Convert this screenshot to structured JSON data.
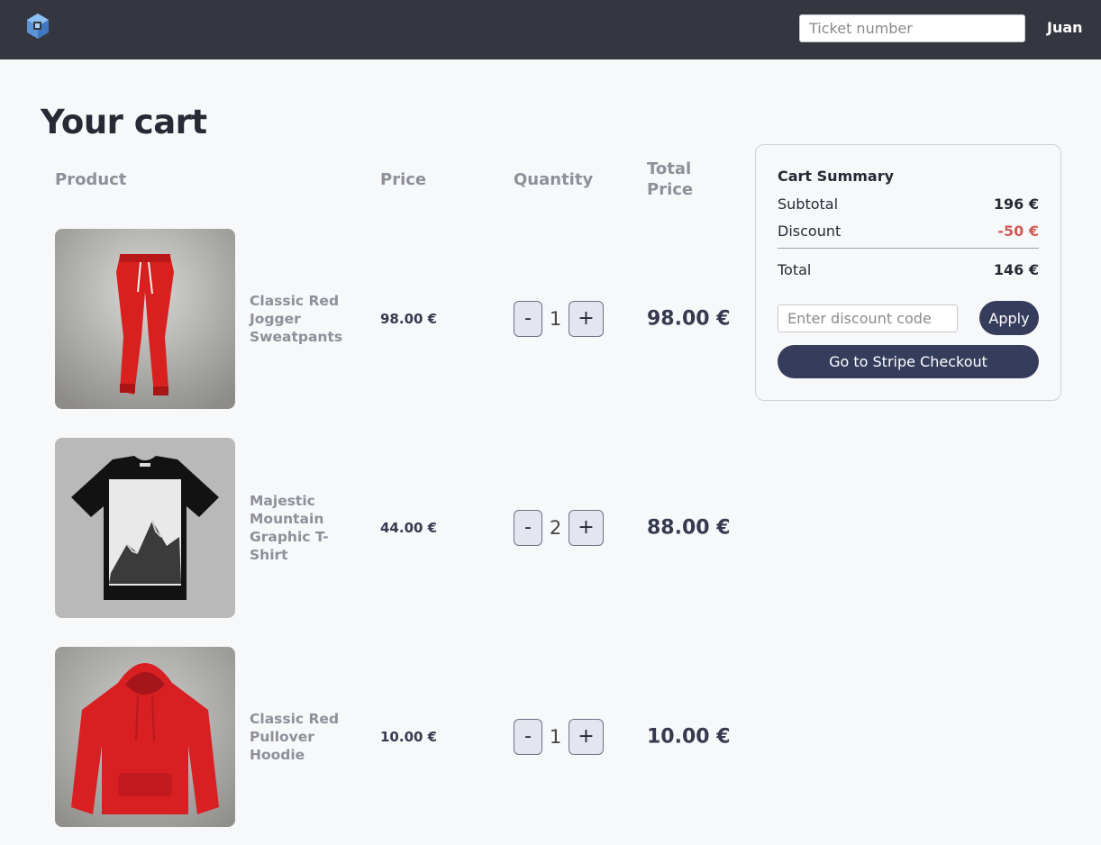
{
  "navbar": {
    "logo_icon": "cube-logo-icon",
    "ticket_placeholder": "Ticket number",
    "user_name": "Juan"
  },
  "page": {
    "title": "Your cart"
  },
  "table": {
    "headers": {
      "product": "Product",
      "price": "Price",
      "quantity": "Quantity",
      "total_price": "Total Price"
    },
    "items": [
      {
        "name": "Classic Red Jogger Sweatpants",
        "price": "98.00 €",
        "quantity": "1",
        "total": "98.00 €",
        "minus": "-",
        "plus": "+"
      },
      {
        "name": "Majestic Mountain Graphic T-Shirt",
        "price": "44.00 €",
        "quantity": "2",
        "total": "88.00 €",
        "minus": "-",
        "plus": "+"
      },
      {
        "name": "Classic Red Pullover Hoodie",
        "price": "10.00 €",
        "quantity": "1",
        "total": "10.00 €",
        "minus": "-",
        "plus": "+"
      }
    ]
  },
  "summary": {
    "title": "Cart Summary",
    "subtotal_label": "Subtotal",
    "subtotal_value": "196 €",
    "discount_label": "Discount",
    "discount_value": "-50 €",
    "total_label": "Total",
    "total_value": "146 €",
    "discount_placeholder": "Enter discount code",
    "apply_label": "Apply",
    "checkout_label": "Go to Stripe Checkout"
  },
  "colors": {
    "navbar": "#343640",
    "background": "#f7f8fa",
    "accent_button": "#363d5c",
    "discount": "#d05a57",
    "logo": "#6aa6e8"
  }
}
